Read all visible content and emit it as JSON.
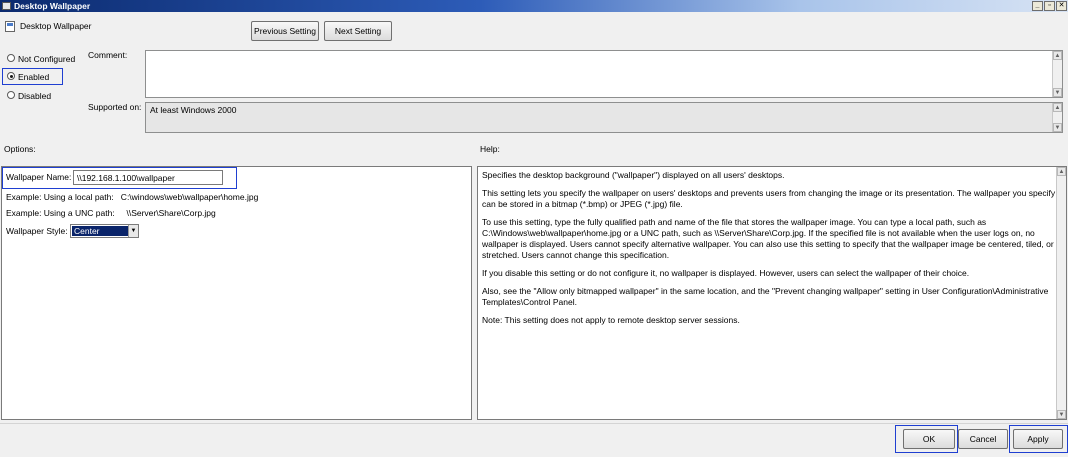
{
  "window": {
    "title": "Desktop Wallpaper",
    "controls": {
      "minimize": "_",
      "restore": "▫",
      "close": "✕"
    }
  },
  "header": {
    "policy_name": "Desktop Wallpaper",
    "previous_label": "Previous Setting",
    "next_label": "Next Setting"
  },
  "state": {
    "options": [
      {
        "label": "Not Configured",
        "checked": false
      },
      {
        "label": "Enabled",
        "checked": true
      },
      {
        "label": "Disabled",
        "checked": false
      }
    ]
  },
  "comment": {
    "label": "Comment:",
    "value": ""
  },
  "supported": {
    "label": "Supported on:",
    "value": "At least Windows 2000"
  },
  "options_section": {
    "label": "Options:",
    "wallpaper_name_label": "Wallpaper Name:",
    "wallpaper_name_value": "\\\\192.168.1.100\\wallpaper",
    "example_local": "Example: Using a local path:   C:\\windows\\web\\wallpaper\\home.jpg",
    "example_unc": "Example: Using a UNC path:     \\\\Server\\Share\\Corp.jpg",
    "style_label": "Wallpaper Style:",
    "style_value": "Center"
  },
  "help_section": {
    "label": "Help:",
    "paragraphs": [
      "Specifies the desktop background (\"wallpaper\") displayed on all users' desktops.",
      "This setting lets you specify the wallpaper on users' desktops and prevents users from changing the image or its presentation. The wallpaper you specify can be stored in a bitmap (*.bmp) or JPEG (*.jpg) file.",
      "To use this setting, type the fully qualified path and name of the file that stores the wallpaper image. You can type a local path, such as C:\\Windows\\web\\wallpaper\\home.jpg or a UNC path, such as \\\\Server\\Share\\Corp.jpg. If the specified file is not available when the user logs on, no wallpaper is displayed. Users cannot specify alternative wallpaper. You can also use this setting to specify that the wallpaper image be centered, tiled, or stretched. Users cannot change this specification.",
      "If you disable this setting or do not configure it, no wallpaper is displayed. However, users can select the wallpaper of their choice.",
      "Also, see the \"Allow only bitmapped wallpaper\" in the same location, and the \"Prevent changing wallpaper\" setting in User Configuration\\Administrative Templates\\Control Panel.",
      "Note: This setting does not apply to remote desktop server sessions."
    ]
  },
  "footer": {
    "ok_label": "OK",
    "cancel_label": "Cancel",
    "apply_label": "Apply"
  },
  "colors": {
    "highlight": "#1f3fd1",
    "selection": "#0a246a",
    "titlebar": "#0b2a6e"
  }
}
